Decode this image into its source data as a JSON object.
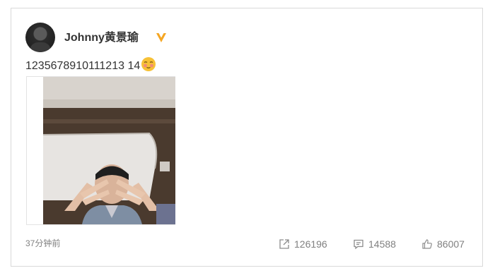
{
  "post": {
    "author": "Johnny黄景瑜",
    "text": "1235678910111213 14",
    "emoji": "flushed-smile-emoji",
    "time": "37分钟前"
  },
  "actions": {
    "share_count": "126196",
    "comment_count": "14588",
    "like_count": "86007"
  },
  "colors": {
    "verified": "#f5a623",
    "text": "#333333",
    "muted": "#808080",
    "border": "#d9d9d9"
  },
  "icons": [
    "verified-icon",
    "share-icon",
    "comment-icon",
    "like-icon"
  ]
}
